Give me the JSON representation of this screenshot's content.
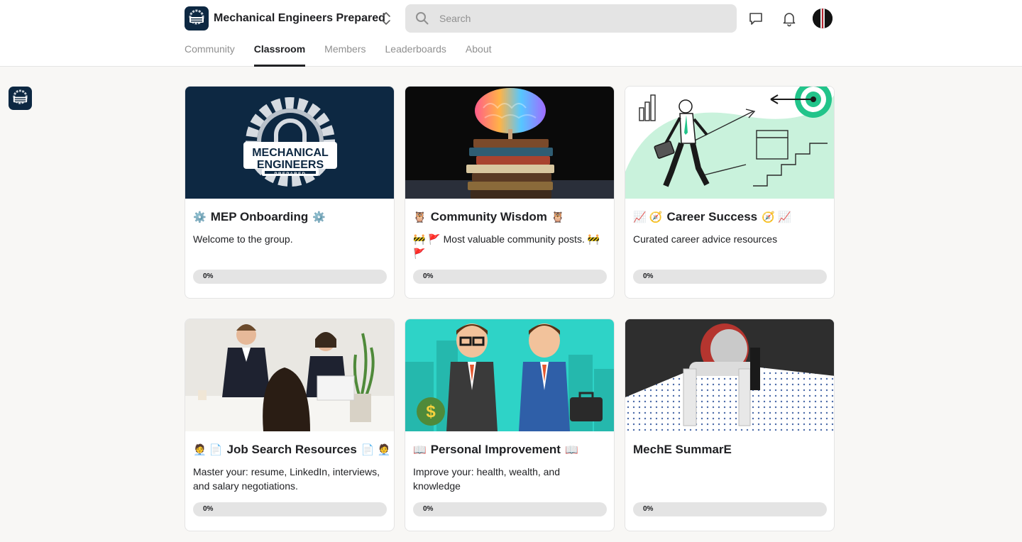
{
  "header": {
    "community_name": "Mechanical Engineers Prepared",
    "search_placeholder": "Search"
  },
  "tabs": [
    {
      "label": "Community",
      "active": false
    },
    {
      "label": "Classroom",
      "active": true
    },
    {
      "label": "Members",
      "active": false
    },
    {
      "label": "Leaderboards",
      "active": false
    },
    {
      "label": "About",
      "active": false
    }
  ],
  "logo": {
    "line1": "MECHANICAL",
    "line2": "ENGINEERS",
    "line3": "PREPARED"
  },
  "courses": [
    {
      "title": "MEP Onboarding",
      "emoji_left": "⚙️",
      "emoji_right": "⚙️",
      "description": "Welcome to the group.",
      "progress_label": "0%",
      "progress": 0
    },
    {
      "title": "Community Wisdom",
      "emoji_left": "🦉",
      "emoji_right": "🦉",
      "description": "🚧 🚩 Most valuable community posts. 🚧 🚩",
      "progress_label": "0%",
      "progress": 0
    },
    {
      "title": "Career Success",
      "emoji_left": "📈 🧭",
      "emoji_right": "🧭 📈",
      "description": "Curated career advice resources",
      "progress_label": "0%",
      "progress": 0
    },
    {
      "title": "Job Search Resources",
      "emoji_left": "🧑‍💼 📄",
      "emoji_right": "📄 🧑‍💼",
      "description": "Master your: resume, LinkedIn, interviews, and salary negotiations.",
      "progress_label": "0%",
      "progress": 0
    },
    {
      "title": "Personal Improvement",
      "emoji_left": "📖",
      "emoji_right": "📖",
      "description": "Improve your: health, wealth, and knowledge",
      "progress_label": "0%",
      "progress": 0
    },
    {
      "title": "MechE SummarE",
      "emoji_left": "",
      "emoji_right": "",
      "description": "",
      "progress_label": "0%",
      "progress": 0
    }
  ],
  "colors": {
    "brand_navy": "#0d2842",
    "progress_track": "#e4e4e4",
    "muted_text": "#909090",
    "mint": "#c9f2dc",
    "teal": "#2ed3c7"
  }
}
